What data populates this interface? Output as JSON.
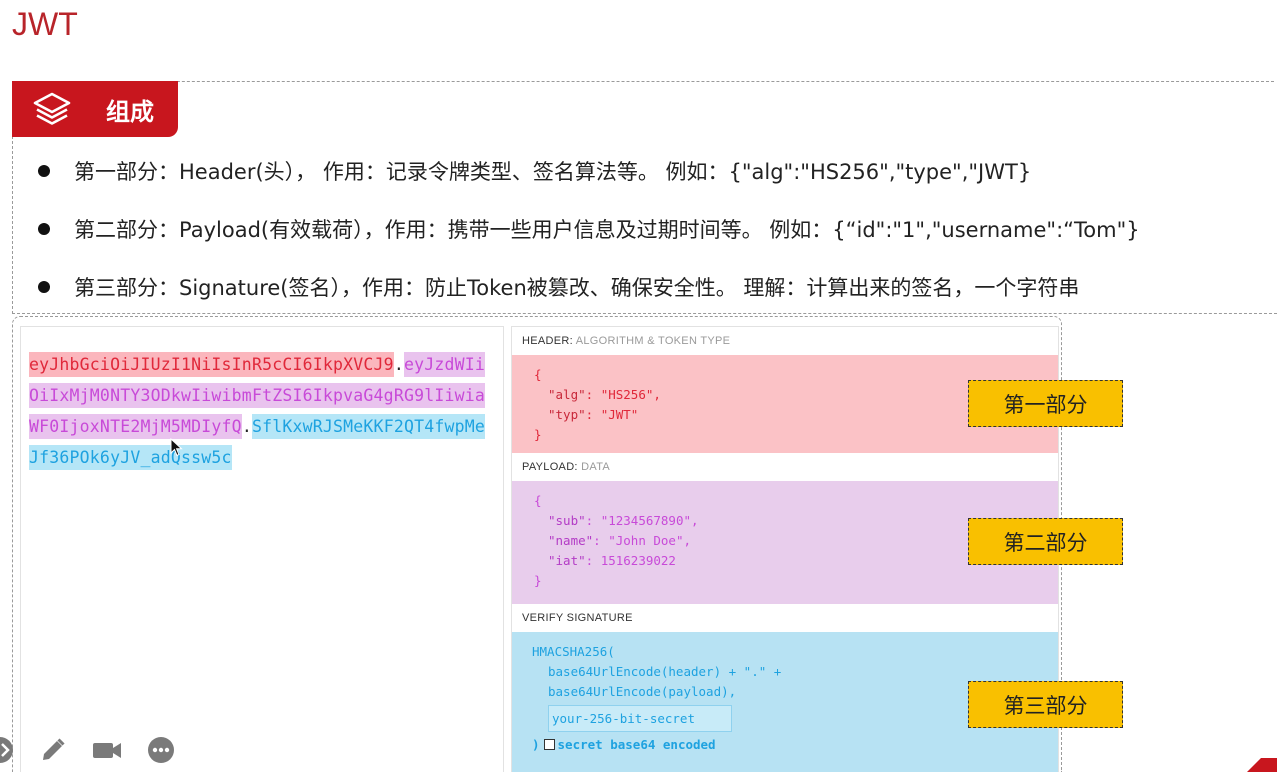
{
  "page": {
    "title": "JWT"
  },
  "section": {
    "tag_label": "组成",
    "bullets": [
      "第一部分：Header(头），  作用：记录令牌类型、签名算法等。 例如：{\"alg\":\"HS256\",\"type\",\"JWT}",
      "第二部分：Payload(有效载荷），作用：携带一些用户信息及过期时间等。 例如：{“id\":\"1\",\"username\":“Tom\"}",
      "第三部分：Signature(签名），作用：防止Token被篡改、确保安全性。 理解：计算出来的签名，一个字符串"
    ]
  },
  "encoded": {
    "header": "eyJhbGciOiJIUzI1NiIsInR5cCI6IkpXVCJ9",
    "payload": "eyJzdWIiOiIxMjM0NTY3ODkwIiwibmFtZSI6IkpvaG4gRG9lIiwiaWF0IjoxNTE2MjM5MDIyfQ",
    "signature": "SflKxwRJSMeKKF2QT4fwpMeJf36POk6yJV_adQssw5c",
    "dot": "."
  },
  "decoded": {
    "header_title": "HEADER:",
    "header_sub": "ALGORITHM & TOKEN TYPE",
    "header_json": {
      "open": "{",
      "alg_key": "\"alg\"",
      "alg_val": "\"HS256\",",
      "typ_key": "\"typ\"",
      "typ_val": "\"JWT\"",
      "close": "}"
    },
    "payload_title": "PAYLOAD:",
    "payload_sub": "DATA",
    "payload_json": {
      "open": "{",
      "sub_key": "\"sub\"",
      "sub_val": "\"1234567890\",",
      "name_key": "\"name\"",
      "name_val": "\"John Doe\",",
      "iat_key": "\"iat\"",
      "iat_val": "1516239022",
      "close": "}"
    },
    "verify_title": "VERIFY SIGNATURE",
    "verify": {
      "fn": "HMACSHA256(",
      "line1": "base64UrlEncode(header) + \".\" +",
      "line2": "base64UrlEncode(payload),",
      "secret_placeholder": "your-256-bit-secret",
      "close": ")",
      "checkbox_label": "secret base64 encoded"
    }
  },
  "part_labels": [
    "第一部分",
    "第二部分",
    "第三部分"
  ],
  "colors": {
    "accent_red": "#c8161e",
    "header_red": "#e0283a",
    "payload_purple": "#c84ad8",
    "signature_blue": "#1ea2e0",
    "label_yellow": "#f9c000"
  },
  "toolbar": {
    "icons": [
      "arrow-icon",
      "pencil-icon",
      "camera-icon",
      "more-icon"
    ]
  }
}
